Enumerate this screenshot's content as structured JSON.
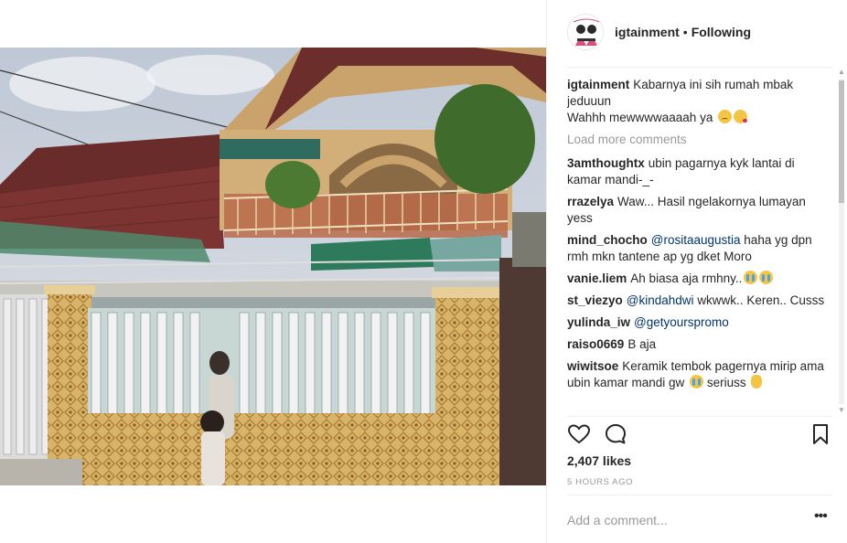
{
  "post": {
    "username": "igtainment",
    "separator": "•",
    "follow_status": "Following",
    "caption": {
      "username": "igtainment",
      "line1": "Kabarnya ini sih rumah mbak jeduuun",
      "line2": "Wahhh mewwwwaaaah ya"
    },
    "load_more_label": "Load more comments",
    "comments": [
      {
        "user": "3amthoughtx",
        "text": "ubin pagarnya kyk lantai di kamar mandi-_-"
      },
      {
        "user": "rrazelya",
        "text": "Waw... Hasil ngelakornya lumayan yess"
      },
      {
        "user": "mind_chocho",
        "mention": "@rositaaugustia",
        "text": "haha yg dpn rmh mkn tantene ap yg dket Moro"
      },
      {
        "user": "vanie.liem",
        "text": "Ah biasa aja rmhny.."
      },
      {
        "user": "st_viezyo",
        "mention": "@kindahdwi",
        "text": "wkwwk.. Keren.. Cusss"
      },
      {
        "user": "yulinda_iw",
        "mention": "@getyourspromo",
        "text": ""
      },
      {
        "user": "raiso0669",
        "text": "B aja"
      },
      {
        "user": "wiwitsoe",
        "text": "Keramik tembok pagernya mirip ama ubin kamar mandi gw",
        "text2": "seriuss"
      }
    ],
    "likes_label": "2,407 likes",
    "timestamp": "5 HOURS AGO",
    "add_comment_placeholder": "Add a comment...",
    "more_options_label": "•••"
  },
  "icons": {
    "like": "heart-icon",
    "comment": "comment-icon",
    "save": "bookmark-icon",
    "options": "more-options-icon"
  },
  "colors": {
    "text": "#262626",
    "muted": "#999999",
    "mention": "#003569",
    "divider": "#efefef"
  }
}
